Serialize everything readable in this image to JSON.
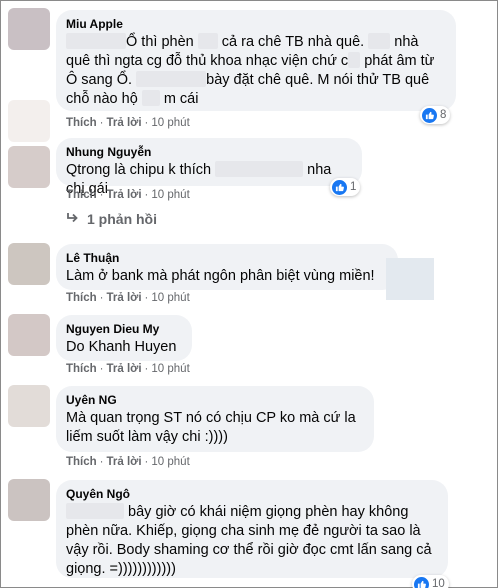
{
  "actions": {
    "like": "Thích",
    "reply": "Trả lời",
    "separator": "·"
  },
  "comments": [
    {
      "author": "Miu Apple",
      "avatar_color": "#c9c0c4",
      "segments": [
        "Ổ thì phèn",
        "cả ra chê TB nhà quê.",
        "nhà quê thì ngta cg đỗ thủ khoa nhạc viện chứ c",
        "phát âm từ Ô sang Ổ.",
        "bày đặt chê quê. M nói thử TB quê chỗ nào hộ",
        "m cái"
      ],
      "time": "10 phút",
      "reaction_count": "8"
    },
    {
      "author": "Nhung Nguyễn",
      "avatar_color": "#d6ccca",
      "segments": [
        "Qtrong là chipu k thích",
        "nha chị gái"
      ],
      "time": "10 phút",
      "reaction_count": "1"
    },
    {
      "author": "Lê Thuận",
      "avatar_color": "#cdc6c0",
      "text": "Làm ở bank mà phát ngôn phân biệt vùng miền!",
      "time": "10 phút"
    },
    {
      "author": "Nguyen Dieu My",
      "avatar_color": "#d3c8c6",
      "text": "Do Khanh Huyen",
      "time": "10 phút"
    },
    {
      "author": "Uyên NG",
      "avatar_color": "#e2dcd8",
      "text": "Mà quan trọng ST nó có chịu CP ko mà cứ la liếm suốt làm vậy chi :))))",
      "time": "10 phút"
    },
    {
      "author": "Quyên Ngô",
      "avatar_color": "#cbc3c1",
      "segments": [
        "bây giờ có khái niệm giọng phèn hay không phèn nữa. Khiếp, giọng cha sinh mẹ đẻ người ta sao là vậy rồi. Body shaming cơ thể rồi giờ đọc cmt lấn sang cả giọng. =))))))))))))"
      ],
      "reaction_count": "10"
    }
  ],
  "replies": {
    "label": "1 phản hồi"
  },
  "colors": {
    "bubble": "#f0f2f5",
    "like_blue": "#1877f2",
    "meta_gray": "#65676b"
  }
}
